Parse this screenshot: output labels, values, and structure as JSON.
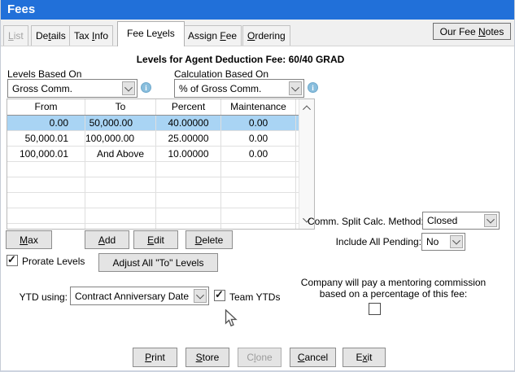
{
  "window": {
    "title": "Fees"
  },
  "tabs": [
    {
      "pre": "",
      "key": "L",
      "post": "ist"
    },
    {
      "pre": "De",
      "key": "t",
      "post": "ails"
    },
    {
      "pre": "Tax ",
      "key": "I",
      "post": "nfo"
    },
    {
      "pre": "Fee Le",
      "key": "v",
      "post": "els"
    },
    {
      "pre": "Assign ",
      "key": "F",
      "post": "ee"
    },
    {
      "pre": "",
      "key": "O",
      "post": "rdering"
    }
  ],
  "fee_notes": {
    "pre": "Our Fee ",
    "key": "N",
    "post": "otes"
  },
  "main": {
    "title": "Levels for Agent Deduction Fee: 60/40 GRAD"
  },
  "based_on": {
    "label": "Levels Based On",
    "value": "Gross Comm."
  },
  "calc_on": {
    "label": "Calculation Based On",
    "value": "% of Gross Comm."
  },
  "table": {
    "headers": [
      "From",
      "To",
      "Percent",
      "Maintenance"
    ],
    "rows": [
      [
        "0.00",
        "50,000.00",
        "40.00000",
        "0.00"
      ],
      [
        "50,000.01",
        "100,000.00",
        "25.00000",
        "0.00"
      ],
      [
        "100,000.01",
        "And Above",
        "10.00000",
        "0.00"
      ]
    ],
    "selected_row_index": 0
  },
  "actions": {
    "max": {
      "pre": "",
      "key": "M",
      "post": "ax"
    },
    "add": {
      "pre": "",
      "key": "A",
      "post": "dd"
    },
    "edit": {
      "pre": "",
      "key": "E",
      "post": "dit"
    },
    "delete": {
      "pre": "",
      "key": "D",
      "post": "elete"
    },
    "adjust": {
      "label": "Adjust All \"To\" Levels"
    }
  },
  "prorate": {
    "label": "Prorate Levels",
    "checked": true
  },
  "comm_split": {
    "label": "Comm. Split Calc. Method:",
    "value": "Closed"
  },
  "pending": {
    "label": "Include All Pending:",
    "value": "No"
  },
  "ytd": {
    "label": "YTD using:",
    "value": "Contract Anniversary Date"
  },
  "team": {
    "label": "Team YTDs",
    "checked": true
  },
  "mentor": {
    "line1": "Company will pay a mentoring commission",
    "line2": "based on a percentage of this fee:",
    "checked": false
  },
  "bottom": {
    "print": {
      "pre": "",
      "key": "P",
      "post": "rint"
    },
    "store": {
      "pre": "",
      "key": "S",
      "post": "tore"
    },
    "clone": {
      "pre": "C",
      "key": "l",
      "post": "one"
    },
    "cancel": {
      "pre": "",
      "key": "C",
      "post": "ancel"
    },
    "exit": {
      "pre": "E",
      "key": "x",
      "post": "it"
    }
  },
  "icons": {
    "info": "i",
    "checkmark": "✓",
    "combo_arrow": "chevron-down",
    "scroll_up": "chevron-up",
    "scroll_down": "chevron-down",
    "cursor": "arrow-pointer"
  },
  "colors": {
    "titlebar": "#2170d9",
    "selected_row": "#a9d4f4",
    "info_icon": "#89bedd",
    "button_face": "#e4e4e4",
    "tab_strip": "#f0f0f0"
  }
}
